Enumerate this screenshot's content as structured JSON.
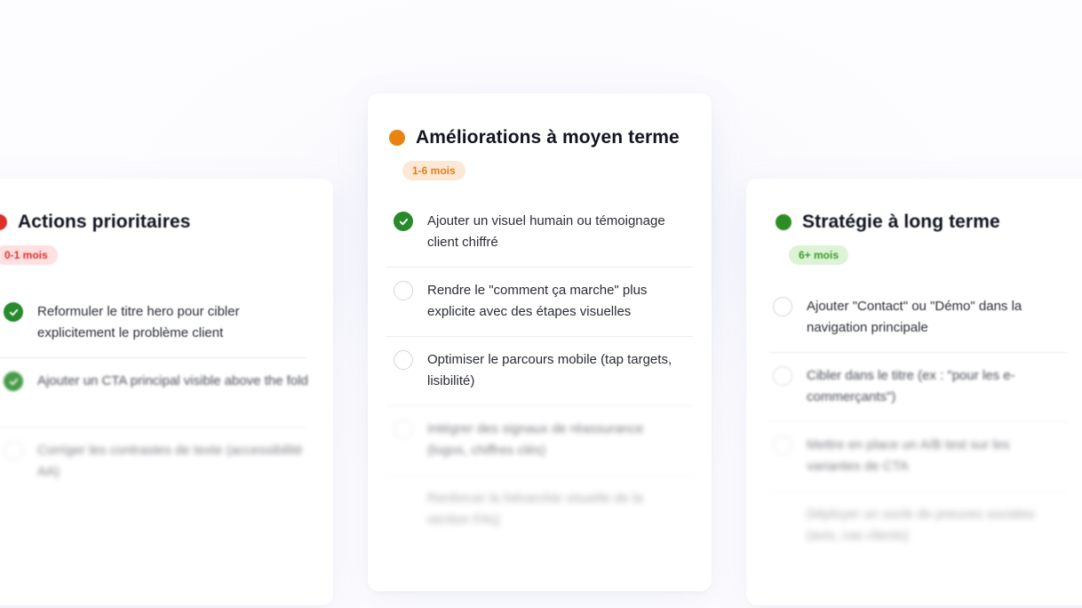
{
  "columns": {
    "left": {
      "title": "Actions prioritaires",
      "badge": "0-1 mois",
      "dot_color": "#d9302c",
      "items": [
        {
          "text": "Reformuler le titre hero pour cibler explicitement le problème client",
          "done": true
        },
        {
          "text": "Ajouter un CTA principal visible above the fold",
          "done": true
        },
        {
          "text": "Corriger les contrastes de texte (accessibilité AA)",
          "done": false
        }
      ]
    },
    "middle": {
      "title": "Améliorations à moyen terme",
      "badge": "1-6 mois",
      "dot_color": "#e8830f",
      "items": [
        {
          "text": "Ajouter un visuel humain ou témoignage client chiffré",
          "done": true
        },
        {
          "text": "Rendre le \"comment ça marche\" plus explicite avec des étapes visuelles",
          "done": false
        },
        {
          "text": "Optimiser le parcours mobile (tap targets, lisibilité)",
          "done": false
        },
        {
          "text": "Intégrer des signaux de réassurance (logos, chiffres clés)",
          "done": false
        },
        {
          "text": "Renforcer la hiérarchie visuelle de la section FAQ",
          "done": false
        }
      ]
    },
    "right": {
      "title": "Stratégie à long terme",
      "badge": "6+ mois",
      "dot_color": "#2c8d22",
      "items": [
        {
          "text": "Ajouter \"Contact\" ou \"Démo\" dans la navigation principale",
          "done": false
        },
        {
          "text": "Cibler dans le titre (ex : \"pour les e-commerçants\")",
          "done": false
        },
        {
          "text": "Mettre en place un A/B test sur les variantes de CTA",
          "done": false
        },
        {
          "text": "Déployer un socle de preuves sociales (avis, cas clients)",
          "done": false
        }
      ]
    }
  },
  "icons": {
    "done": "check-circle-icon",
    "todo": "empty-circle-icon"
  }
}
